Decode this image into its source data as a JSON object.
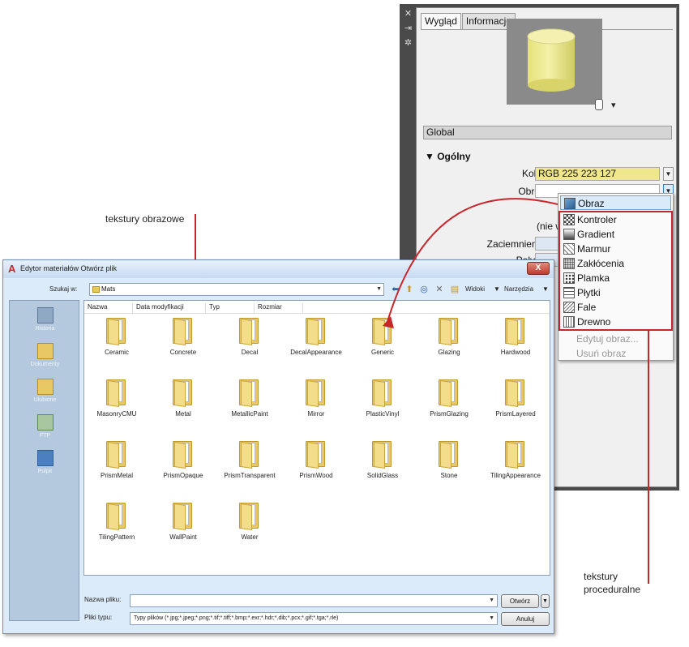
{
  "callouts": {
    "bitmap": "tekstury obrazowe",
    "procedural": "tekstury\nproceduralne"
  },
  "palette": {
    "side_buttons": [
      "close-icon",
      "pin-icon",
      "settings-icon"
    ],
    "tabs": [
      "Wygląd",
      "Informacje"
    ],
    "preview_shape_menu": "▾",
    "global": "Global",
    "section": "Ogólny",
    "labels": {
      "kolor": "Kolor",
      "obraz": "Obraz",
      "nie": "(nie w",
      "zaciemnienie": "Zaciemnienie",
      "polysk": "Połysk"
    },
    "kolor_value": "RGB 225 223 127",
    "kolor_swatch": "#f0e68c"
  },
  "dropdown": {
    "selected": "Obraz",
    "procedural": [
      "Kontroler",
      "Gradient",
      "Marmur",
      "Zakłócenia",
      "Plamka",
      "Płytki",
      "Fale",
      "Drewno"
    ],
    "disabled": [
      "Edytuj obraz...",
      "Usuń obraz"
    ]
  },
  "dialog": {
    "title": "Edytor materiałów Otwórz plik",
    "close": "X",
    "look_in_label": "Szukaj w:",
    "look_in_value": "Mats",
    "views": "Widoki",
    "tools": "Narzędzia",
    "places": [
      "Historia",
      "Dokumenty",
      "Ulubione",
      "FTP",
      "Pulpit"
    ],
    "columns": [
      "Nazwa",
      "Data modyfikacji",
      "Typ",
      "Rozmiar"
    ],
    "folders": [
      "Ceramic",
      "Concrete",
      "Decal",
      "DecalAppearance",
      "Generic",
      "Glazing",
      "Hardwood",
      "MasonryCMU",
      "Metal",
      "MetallicPaint",
      "Mirror",
      "PlasticVinyl",
      "PrismGlazing",
      "PrismLayered",
      "PrismMetal",
      "PrismOpaque",
      "PrismTransparent",
      "PrismWood",
      "SolidGlass",
      "Stone",
      "TilingAppearance",
      "TilingPattern",
      "WallPaint",
      "Water"
    ],
    "filename_label": "Nazwa pliku:",
    "filename_value": "",
    "filetype_label": "Pliki typu:",
    "filetype_value": "Typy plików  (*.jpg;*.jpeg;*.png;*.tif;*.tiff;*.bmp;*.exr;*.hdr;*.dib;*.pcx;*.gif;*.tga;*.rle)",
    "open_button": "Otwórz",
    "cancel_button": "Anuluj"
  },
  "colors": {
    "accent_red": "#c8262b",
    "folder_yellow": "#e8c865"
  }
}
